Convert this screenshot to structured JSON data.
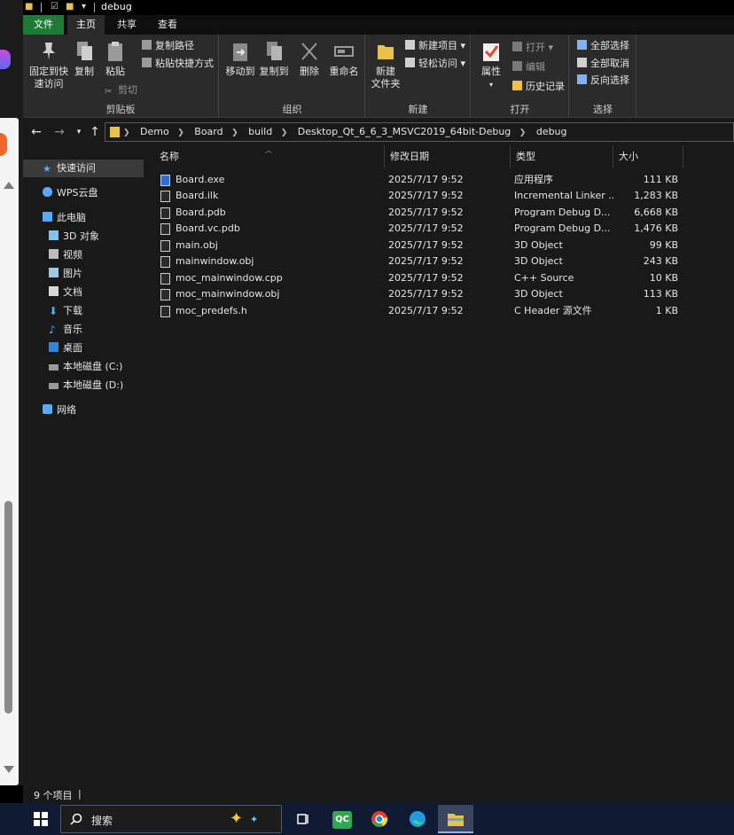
{
  "window": {
    "title": "debug"
  },
  "tabs": [
    {
      "label": "文件"
    },
    {
      "label": "主页"
    },
    {
      "label": "共享"
    },
    {
      "label": "查看"
    }
  ],
  "ribbon": {
    "clipboard": {
      "label": "剪贴板",
      "pin": "固定到快速访问",
      "pin_line1": "固定到快",
      "pin_line2": "速访问",
      "copy": "复制",
      "paste": "粘贴",
      "copy_path": "复制路径",
      "paste_shortcut": "粘贴快捷方式",
      "cut": "剪切"
    },
    "organize": {
      "label": "组织",
      "move_to": "移动到",
      "copy_to": "复制到",
      "delete": "删除",
      "rename": "重命名"
    },
    "new": {
      "label": "新建",
      "new_folder_line1": "新建",
      "new_folder_line2": "文件夹",
      "new_item": "新建项目",
      "easy_access": "轻松访问"
    },
    "open": {
      "label": "打开",
      "properties": "属性",
      "open": "打开",
      "edit": "编辑",
      "history": "历史记录"
    },
    "select": {
      "label": "选择",
      "select_all": "全部选择",
      "select_none": "全部取消",
      "invert": "反向选择"
    }
  },
  "address": {
    "crumbs": [
      "Demo",
      "Board",
      "build",
      "Desktop_Qt_6_6_3_MSVC2019_64bit-Debug",
      "debug"
    ]
  },
  "nav": {
    "quick_access": "快速访问",
    "wps": "WPS云盘",
    "this_pc": "此电脑",
    "objects3d": "3D 对象",
    "videos": "视频",
    "pictures": "图片",
    "documents": "文档",
    "downloads": "下载",
    "music": "音乐",
    "desktop": "桌面",
    "drive_c": "本地磁盘 (C:)",
    "drive_d": "本地磁盘 (D:)",
    "network": "网络"
  },
  "columns": {
    "name": "名称",
    "date": "修改日期",
    "type": "类型",
    "size": "大小"
  },
  "files": [
    {
      "name": "Board.exe",
      "date": "2025/7/17 9:52",
      "type": "应用程序",
      "size": "111 KB"
    },
    {
      "name": "Board.ilk",
      "date": "2025/7/17 9:52",
      "type": "Incremental Linker ...",
      "size": "1,283 KB"
    },
    {
      "name": "Board.pdb",
      "date": "2025/7/17 9:52",
      "type": "Program Debug D...",
      "size": "6,668 KB"
    },
    {
      "name": "Board.vc.pdb",
      "date": "2025/7/17 9:52",
      "type": "Program Debug D...",
      "size": "1,476 KB"
    },
    {
      "name": "main.obj",
      "date": "2025/7/17 9:52",
      "type": "3D Object",
      "size": "99 KB"
    },
    {
      "name": "mainwindow.obj",
      "date": "2025/7/17 9:52",
      "type": "3D Object",
      "size": "243 KB"
    },
    {
      "name": "moc_mainwindow.cpp",
      "date": "2025/7/17 9:52",
      "type": "C++ Source",
      "size": "10 KB"
    },
    {
      "name": "moc_mainwindow.obj",
      "date": "2025/7/17 9:52",
      "type": "3D Object",
      "size": "113 KB"
    },
    {
      "name": "moc_predefs.h",
      "date": "2025/7/17 9:52",
      "type": "C Header 源文件",
      "size": "1 KB"
    }
  ],
  "status": {
    "item_count": "9 个项目"
  },
  "taskbar": {
    "search": "搜索",
    "qc_label": "QC"
  },
  "colors": {
    "file_tab": "#1e7b35",
    "folder": "#e8c24a",
    "accent": "#8ab4f8"
  }
}
